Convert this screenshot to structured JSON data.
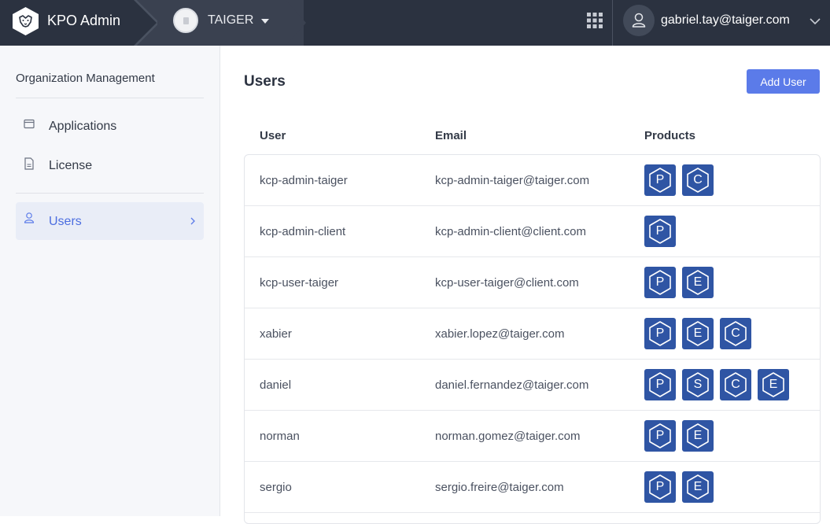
{
  "header": {
    "app_name": "KPO Admin",
    "org_name": "TAIGER",
    "user_email": "gabriel.tay@taiger.com",
    "icons": [
      "lion-logo-icon",
      "chevron-right-icon",
      "caret-down-icon",
      "apps-grid-icon",
      "user-icon",
      "chevron-down-icon"
    ]
  },
  "sidebar": {
    "title": "Organization Management",
    "items": [
      {
        "label": "Applications",
        "icon": "window-icon"
      },
      {
        "label": "License",
        "icon": "document-icon"
      },
      {
        "label": "Users",
        "icon": "user-icon",
        "active": true
      }
    ]
  },
  "main": {
    "title": "Users",
    "add_button": "Add User",
    "columns": [
      "User",
      "Email",
      "Products"
    ],
    "rows": [
      {
        "user": "kcp-admin-taiger",
        "email": "kcp-admin-taiger@taiger.com",
        "products": [
          "P",
          "C"
        ]
      },
      {
        "user": "kcp-admin-client",
        "email": "kcp-admin-client@client.com",
        "products": [
          "P"
        ]
      },
      {
        "user": "kcp-user-taiger",
        "email": "kcp-user-taiger@client.com",
        "products": [
          "P",
          "E"
        ]
      },
      {
        "user": "xabier",
        "email": "xabier.lopez@taiger.com",
        "products": [
          "P",
          "E",
          "C"
        ]
      },
      {
        "user": "daniel",
        "email": "daniel.fernandez@taiger.com",
        "products": [
          "P",
          "S",
          "C",
          "E"
        ]
      },
      {
        "user": "norman",
        "email": "norman.gomez@taiger.com",
        "products": [
          "P",
          "E"
        ]
      },
      {
        "user": "sergio",
        "email": "sergio.freire@taiger.com",
        "products": [
          "P",
          "E"
        ]
      }
    ]
  },
  "colors": {
    "topbar": "#2b3240",
    "accent": "#5b7be9",
    "product_badge": "#2f55a4",
    "active_nav_text": "#4c6ee0"
  }
}
